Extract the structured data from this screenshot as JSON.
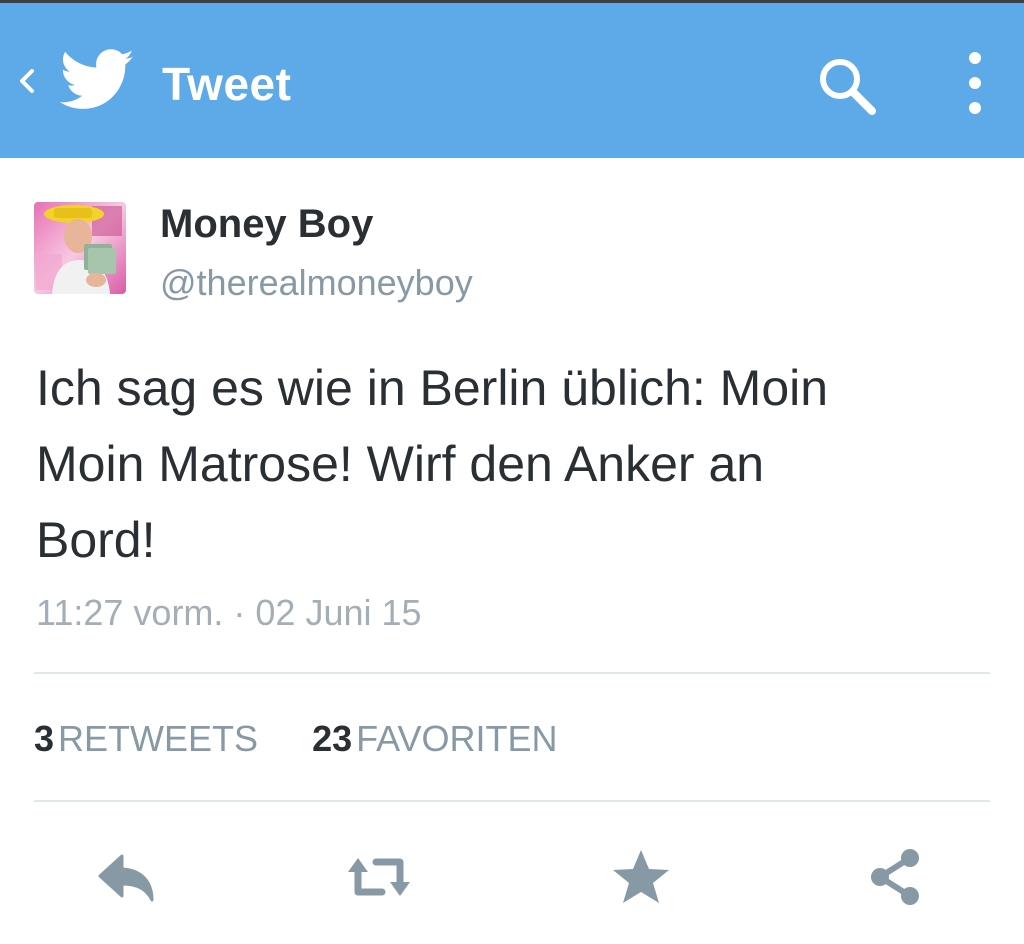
{
  "app_bar": {
    "title": "Tweet",
    "icons": {
      "back": "chevron-left-icon",
      "logo": "twitter-bird-icon",
      "search": "search-icon",
      "more": "more-vertical-icon"
    },
    "colors": {
      "background": "#5ea9e8",
      "foreground": "#ffffff"
    }
  },
  "tweet": {
    "author": {
      "name": "Money Boy",
      "handle": "@therealmoneyboy"
    },
    "text_lines": [
      "Ich sag es wie in Berlin üblich: Moin",
      "Moin Matrose! Wirf den Anker an",
      "Bord!"
    ],
    "timestamp": "11:27 vorm. · 02 Juni 15",
    "stats": {
      "retweets_count": "3",
      "retweets_label": "RETWEETS",
      "favorites_count": "23",
      "favorites_label": "FAVORITEN"
    }
  },
  "actions": [
    {
      "name": "reply",
      "icon": "reply-icon"
    },
    {
      "name": "retweet",
      "icon": "retweet-icon"
    },
    {
      "name": "favorite",
      "icon": "star-icon"
    },
    {
      "name": "share",
      "icon": "share-icon"
    }
  ],
  "colors": {
    "text_primary": "#292f33",
    "text_secondary": "#8899a6",
    "icon_gray": "#8899a6",
    "divider": "#e1e8ed"
  }
}
